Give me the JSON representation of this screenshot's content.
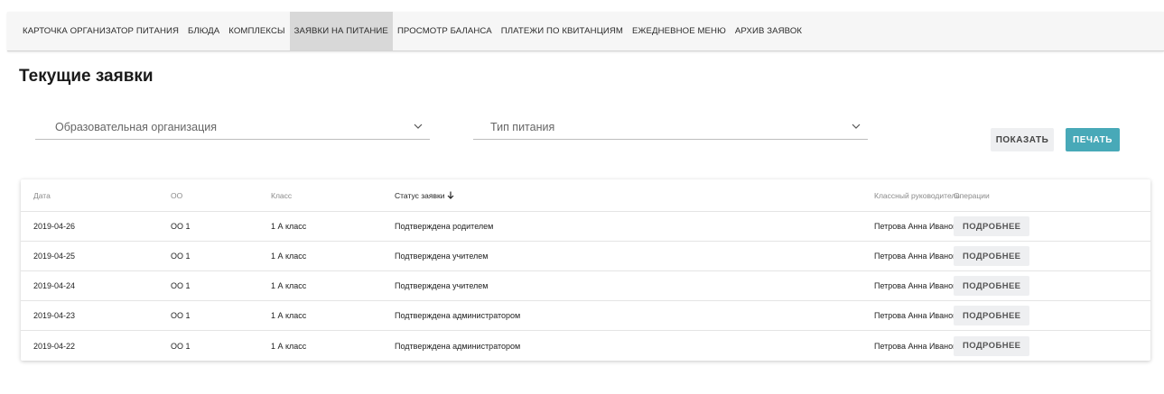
{
  "nav": {
    "items": [
      {
        "label": "КАРТОЧКА ОРГАНИЗАТОР ПИТАНИЯ",
        "active": false
      },
      {
        "label": "БЛЮДА",
        "active": false
      },
      {
        "label": "КОМПЛЕКСЫ",
        "active": false
      },
      {
        "label": "ЗАЯВКИ НА ПИТАНИЕ",
        "active": true
      },
      {
        "label": "ПРОСМОТР БАЛАНСА",
        "active": false
      },
      {
        "label": "ПЛАТЕЖИ ПО КВИТАНЦИЯМ",
        "active": false
      },
      {
        "label": "ЕЖЕДНЕВНОЕ МЕНЮ",
        "active": false
      },
      {
        "label": "АРХИВ ЗАЯВОК",
        "active": false
      }
    ]
  },
  "page": {
    "title": "Текущие заявки"
  },
  "filters": {
    "organization": {
      "placeholder": "Образовательная организация",
      "icon": "chevron-down-icon"
    },
    "meal_type": {
      "placeholder": "Тип питания",
      "icon": "chevron-down-icon"
    }
  },
  "buttons": {
    "show": "ПОКАЗАТЬ",
    "print": "ПЕЧАТЬ"
  },
  "colors": {
    "accent": "#48a9b8",
    "active_tab": "#d8d8d8",
    "button_bg": "#eeeff1"
  },
  "table": {
    "headers": {
      "date": "Дата",
      "oo": "ОО",
      "class": "Класс",
      "status": "Статус заявки",
      "status_sort_icon": "arrow-down-icon",
      "teacher": "Классный руководитель",
      "ops": "Операции"
    },
    "rows": [
      {
        "date": "2019-04-26",
        "oo": "ОО 1",
        "class": "1 А класс",
        "status": "Подтверждена родителем",
        "teacher": "Петрова Анна Ивановна",
        "action": "ПОДРОБНЕЕ"
      },
      {
        "date": "2019-04-25",
        "oo": "ОО 1",
        "class": "1 А класс",
        "status": "Подтверждена учителем",
        "teacher": "Петрова Анна Ивановна",
        "action": "ПОДРОБНЕЕ"
      },
      {
        "date": "2019-04-24",
        "oo": "ОО 1",
        "class": "1 А класс",
        "status": "Подтверждена учителем",
        "teacher": "Петрова Анна Ивановна",
        "action": "ПОДРОБНЕЕ"
      },
      {
        "date": "2019-04-23",
        "oo": "ОО 1",
        "class": "1 А класс",
        "status": "Подтверждена администратором",
        "teacher": "Петрова Анна Ивановна",
        "action": "ПОДРОБНЕЕ"
      },
      {
        "date": "2019-04-22",
        "oo": "ОО 1",
        "class": "1 А класс",
        "status": "Подтверждена администратором",
        "teacher": "Петрова Анна Ивановна",
        "action": "ПОДРОБНЕЕ"
      }
    ]
  }
}
